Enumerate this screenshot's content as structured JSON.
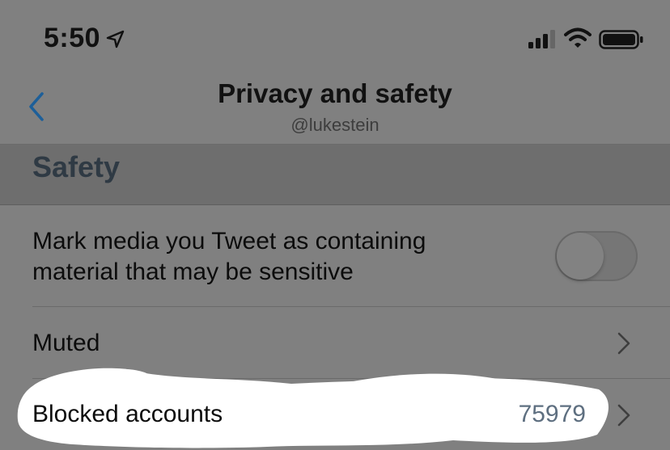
{
  "status_bar": {
    "time": "5:50",
    "icons": [
      "location-arrow-icon",
      "cellular-signal-icon",
      "wifi-icon",
      "battery-icon"
    ]
  },
  "nav": {
    "back_icon": "chevron-left-icon",
    "title": "Privacy and safety",
    "subtitle": "@lukestein"
  },
  "section": {
    "title": "Safety"
  },
  "rows": [
    {
      "label_line1": "Mark media you Tweet as containing",
      "label_line2": "material that may be sensitive",
      "control": "toggle",
      "toggle_on": false
    },
    {
      "label": "Muted",
      "control": "chevron-right-icon"
    },
    {
      "label": "Blocked accounts",
      "value": "75979",
      "control": "chevron-right-icon"
    }
  ],
  "colors": {
    "accent_blue": "#1d5f99",
    "dimmed_background": "#808080",
    "value_text": "#5e6f80",
    "highlight_white": "#ffffff"
  }
}
